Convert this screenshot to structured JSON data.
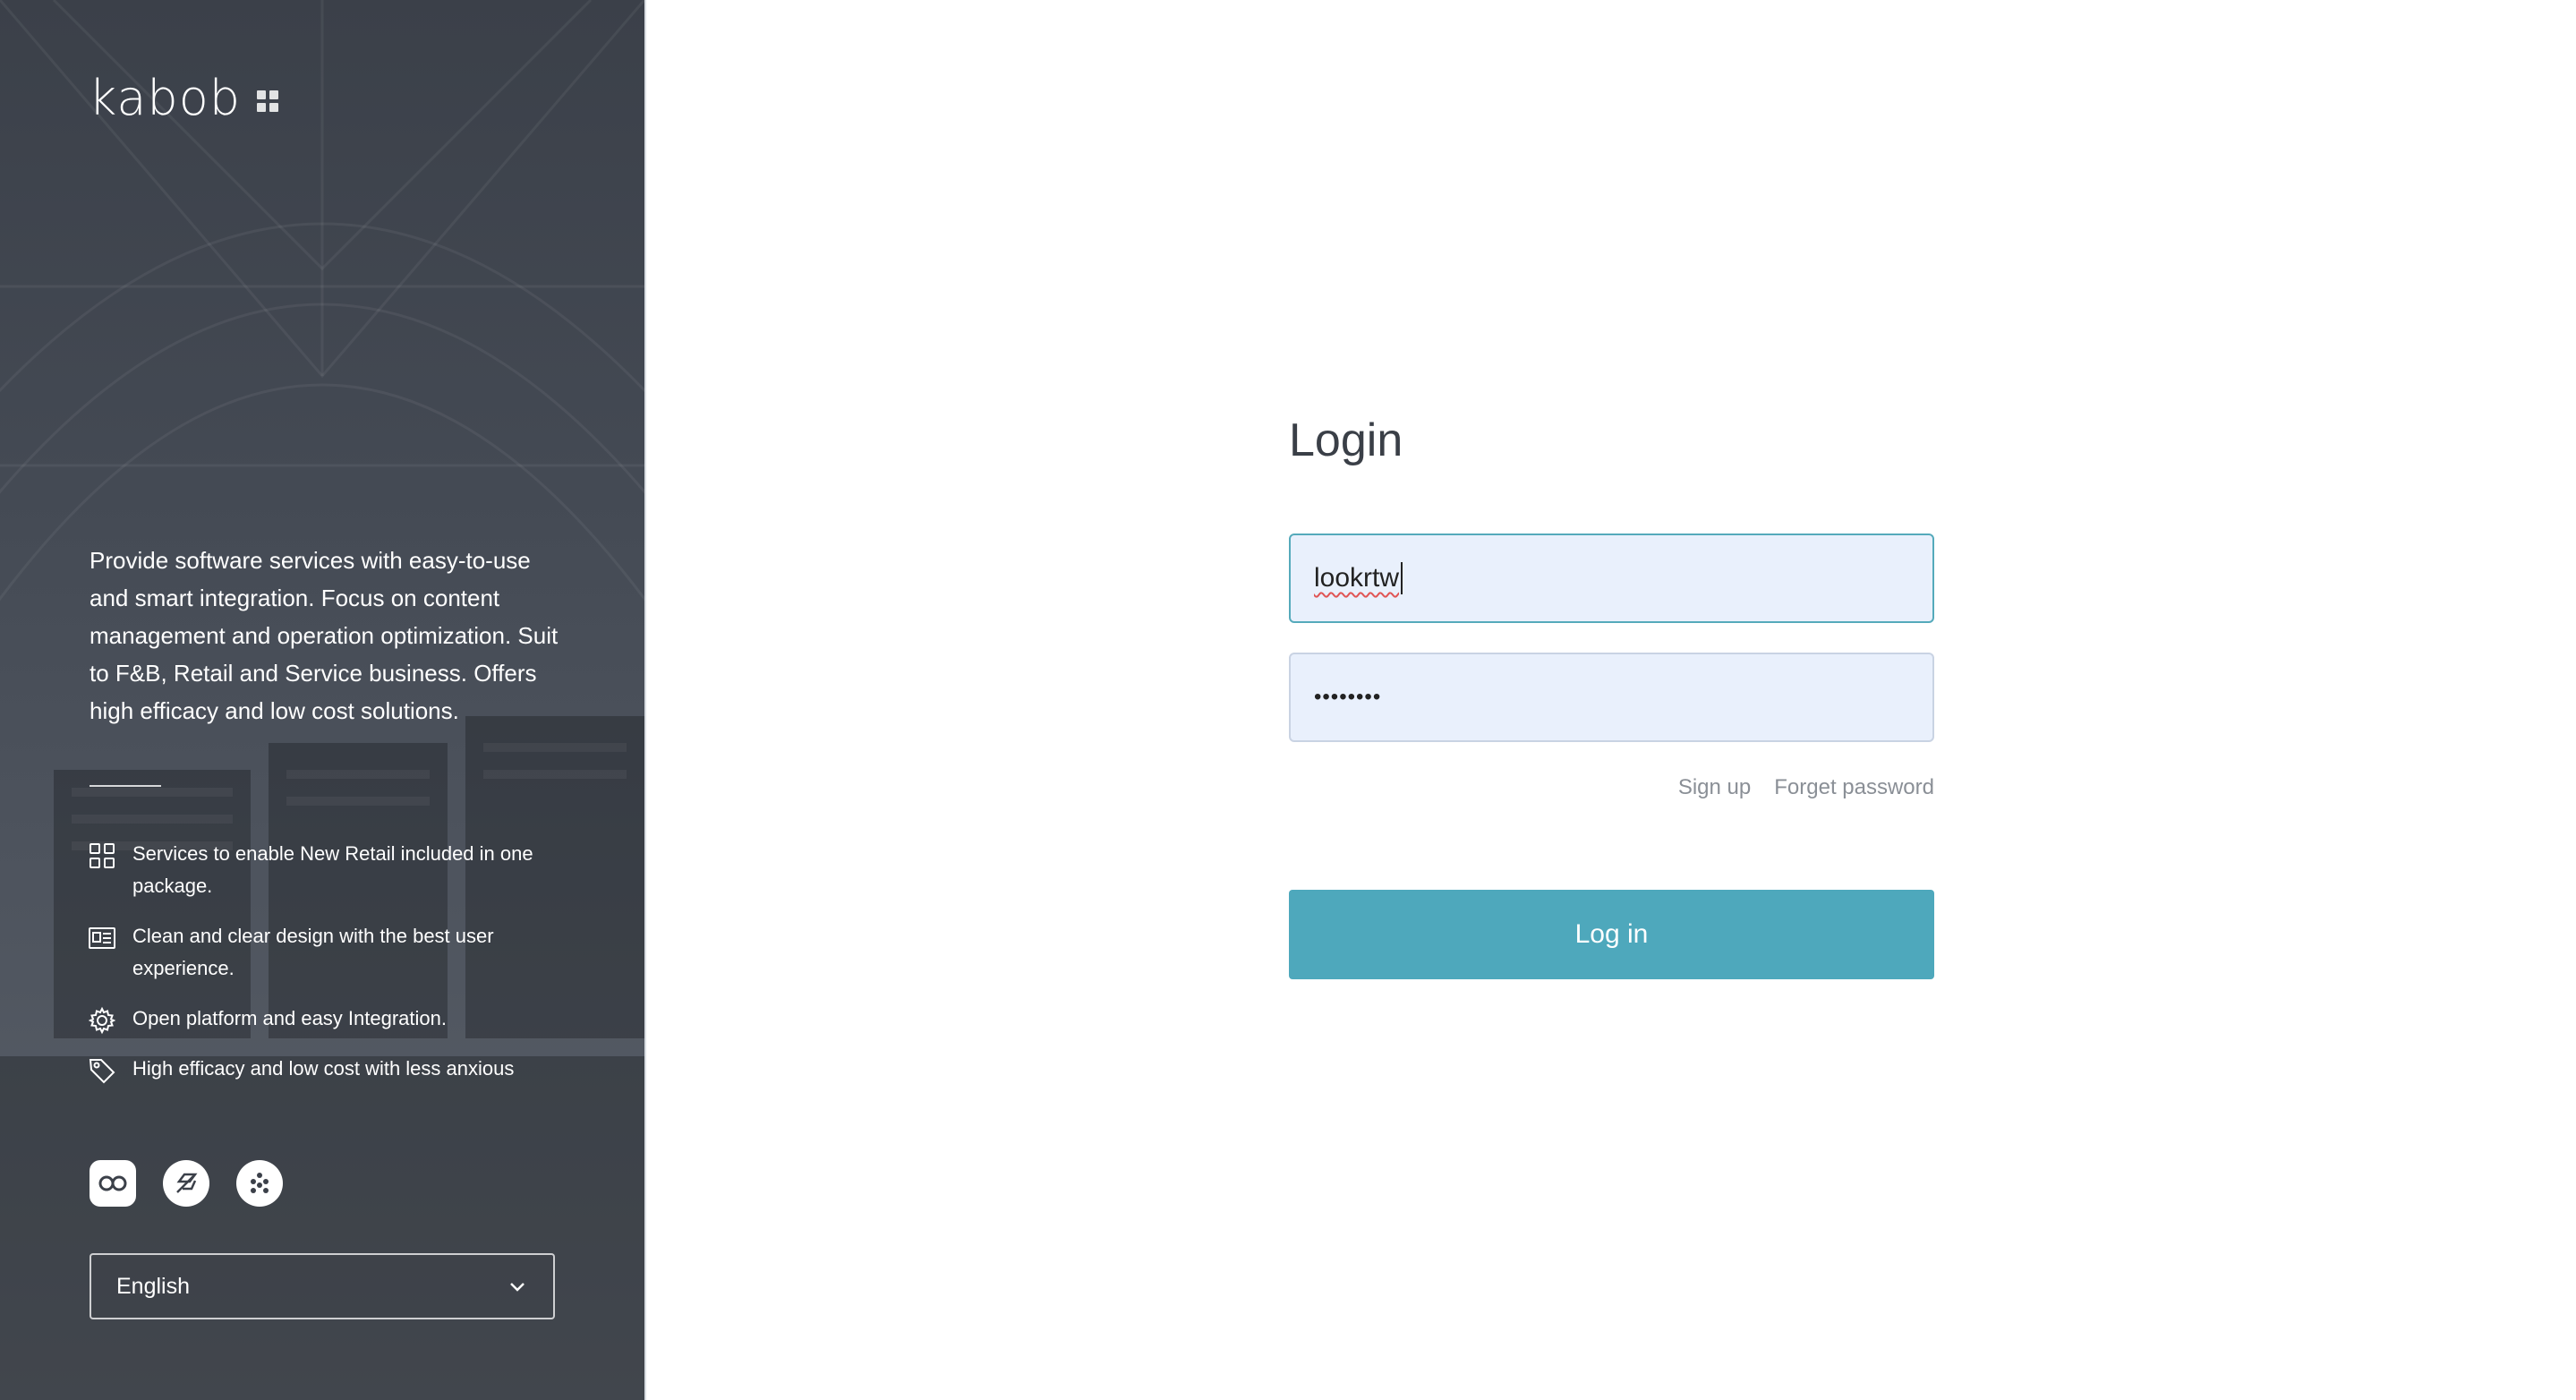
{
  "brand": {
    "name": "kabob"
  },
  "left": {
    "tagline": "Provide software services with easy-to-use and smart integration. Focus on content management and operation optimization. Suit to F&B, Retail and Service business. Offers high efficacy and low cost solutions.",
    "features": [
      {
        "icon": "grid-icon",
        "text": "Services to enable New Retail included in one package."
      },
      {
        "icon": "design-card-icon",
        "text": "Clean and clear design with the best user experience."
      },
      {
        "icon": "gear-icon",
        "text": "Open platform and easy Integration."
      },
      {
        "icon": "tag-icon",
        "text": "High efficacy and low cost with less anxious"
      }
    ],
    "partners": [
      "infinity-logo-icon",
      "leaf-logo-icon",
      "dots-logo-icon"
    ],
    "language": {
      "selected": "English"
    }
  },
  "login": {
    "title": "Login",
    "username_value": "lookrtw",
    "password_masked": "••••••••",
    "links": {
      "signup": "Sign up",
      "forget": "Forget password"
    },
    "button": "Log in"
  },
  "colors": {
    "panel_dark": "#3b4049",
    "accent_button": "#4ea8bc",
    "input_bg": "#e9f0fc",
    "focus_border": "#55aabb",
    "title_text": "#3a3f47",
    "link_text": "#8a8f96"
  }
}
